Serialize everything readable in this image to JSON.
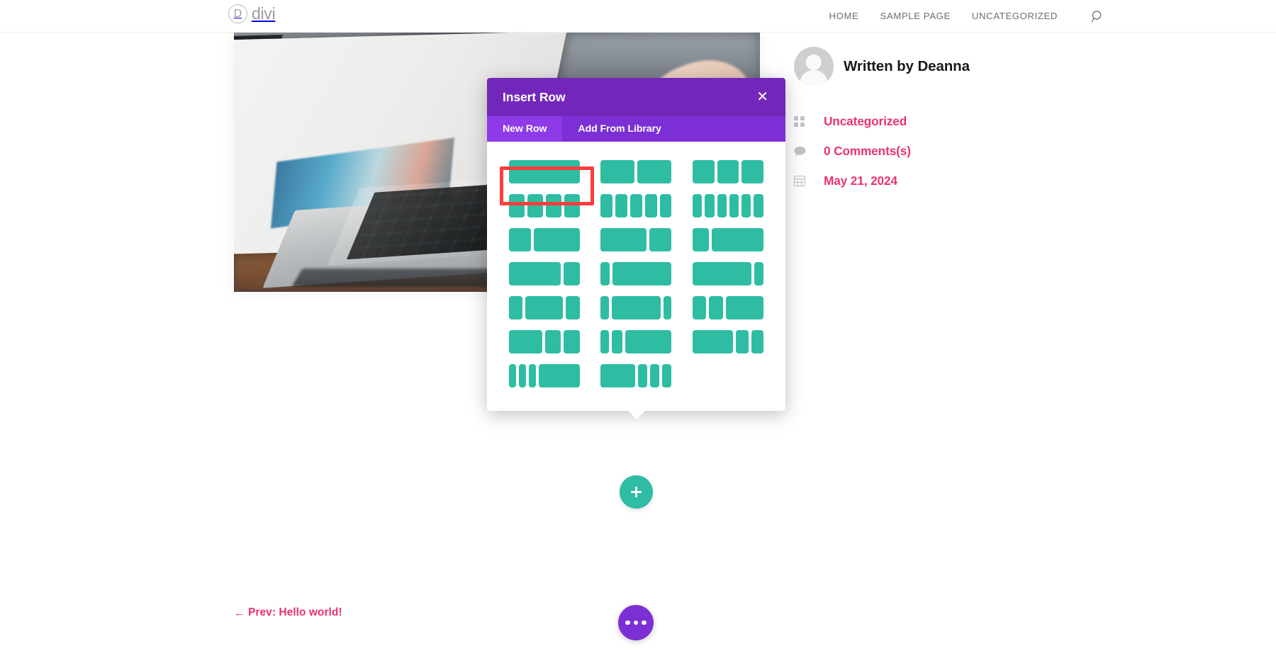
{
  "header": {
    "logo_letter": "D",
    "logo_text": "divi",
    "nav_items": [
      {
        "label": "HOME"
      },
      {
        "label": "SAMPLE PAGE"
      },
      {
        "label": "UNCATEGORIZED"
      }
    ],
    "search_icon": "search-icon"
  },
  "sidebar": {
    "author_label": "Written by Deanna",
    "meta": [
      {
        "icon": "category-grid-icon",
        "label": "Uncategorized"
      },
      {
        "icon": "comment-bubble-icon",
        "label": "0 Comments(s)"
      },
      {
        "icon": "calendar-icon",
        "label": "May 21, 2024"
      }
    ]
  },
  "post_nav": {
    "prev_arrow": "←",
    "prev_label": "Prev: Hello world!"
  },
  "buttons": {
    "add_row_icon": "plus-icon",
    "menu_fab_icon": "ellipsis-icon"
  },
  "modal": {
    "title": "Insert Row",
    "close_label": "✕",
    "tabs": [
      {
        "label": "New Row",
        "active": true
      },
      {
        "label": "Add From Library",
        "active": false
      }
    ],
    "layouts": [
      {
        "name": "1-column",
        "widths": [
          100
        ],
        "selected": true
      },
      {
        "name": "2-column",
        "widths": [
          50,
          50
        ],
        "selected": false
      },
      {
        "name": "3-column",
        "widths": [
          33.3,
          33.3,
          33.3
        ],
        "selected": false
      },
      {
        "name": "4-column",
        "widths": [
          25,
          25,
          25,
          25
        ],
        "selected": false
      },
      {
        "name": "5-column",
        "widths": [
          20,
          20,
          20,
          20,
          20
        ],
        "selected": false
      },
      {
        "name": "6-column",
        "widths": [
          16.6,
          16.6,
          16.6,
          16.6,
          16.6,
          16.6
        ],
        "selected": false
      },
      {
        "name": "third-twothirds",
        "widths": [
          33.3,
          66.6
        ],
        "selected": false
      },
      {
        "name": "twothirds-third",
        "widths": [
          66.6,
          33.3
        ],
        "selected": false
      },
      {
        "name": "quarter-threequarters",
        "widths": [
          25,
          75
        ],
        "selected": false
      },
      {
        "name": "threequarters-quarter",
        "widths": [
          75,
          25
        ],
        "selected": false
      },
      {
        "name": "fifth-fourfifths",
        "widths": [
          15,
          85
        ],
        "selected": false
      },
      {
        "name": "fourfifths-fifth",
        "widths": [
          85,
          15
        ],
        "selected": false
      },
      {
        "name": "quarter-half-quarter",
        "widths": [
          22,
          56,
          22
        ],
        "selected": false
      },
      {
        "name": "sixth-twothirds-sixth",
        "widths": [
          14,
          72,
          14
        ],
        "selected": false
      },
      {
        "name": "quarter-quarter-half",
        "widths": [
          22,
          22,
          56
        ],
        "selected": false
      },
      {
        "name": "half-quarter-quarter",
        "widths": [
          50,
          25,
          25
        ],
        "selected": false
      },
      {
        "name": "sixth-sixth-twothirds",
        "widths": [
          14,
          18,
          68
        ],
        "selected": false
      },
      {
        "name": "half-sixth-sixth-b",
        "widths": [
          60,
          20,
          20
        ],
        "selected": false
      },
      {
        "name": "sixth-sixth-sixth-half",
        "widths": [
          13,
          13,
          13,
          61
        ],
        "selected": false
      },
      {
        "name": "half-sixth-sixth-sixth",
        "widths": [
          52,
          16,
          16,
          16
        ],
        "selected": false
      }
    ]
  },
  "colors": {
    "accent_teal": "#2ebda3",
    "purple_header": "#7227ba",
    "purple_tabs": "#7b2fd4",
    "purple_active_tab": "#8e3ae8",
    "pink_link": "#e9336c",
    "highlight_red": "#fd3c3c"
  }
}
